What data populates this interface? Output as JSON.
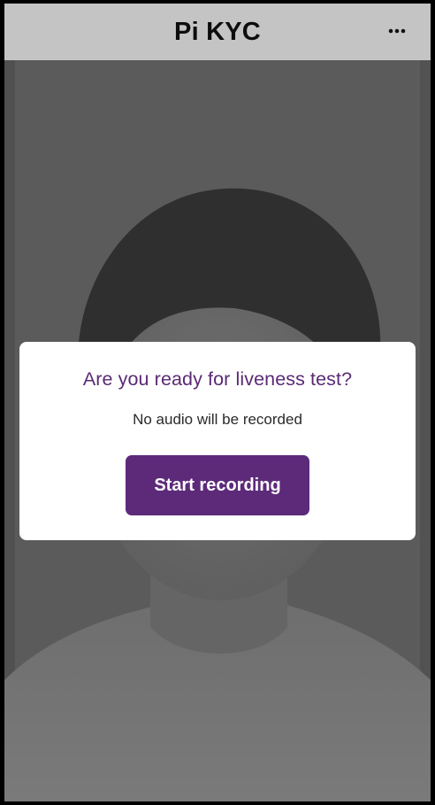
{
  "header": {
    "title": "Pi KYC",
    "menu_icon": "more-horizontal-icon"
  },
  "dialog": {
    "title": "Are you ready for liveness test?",
    "subtitle": "No audio will be recorded",
    "start_label": "Start recording"
  },
  "colors": {
    "accent": "#5d2a7a",
    "title_text": "#5a2a74",
    "header_bg": "#c4c4c4",
    "overlay": "#5a5a5a"
  }
}
